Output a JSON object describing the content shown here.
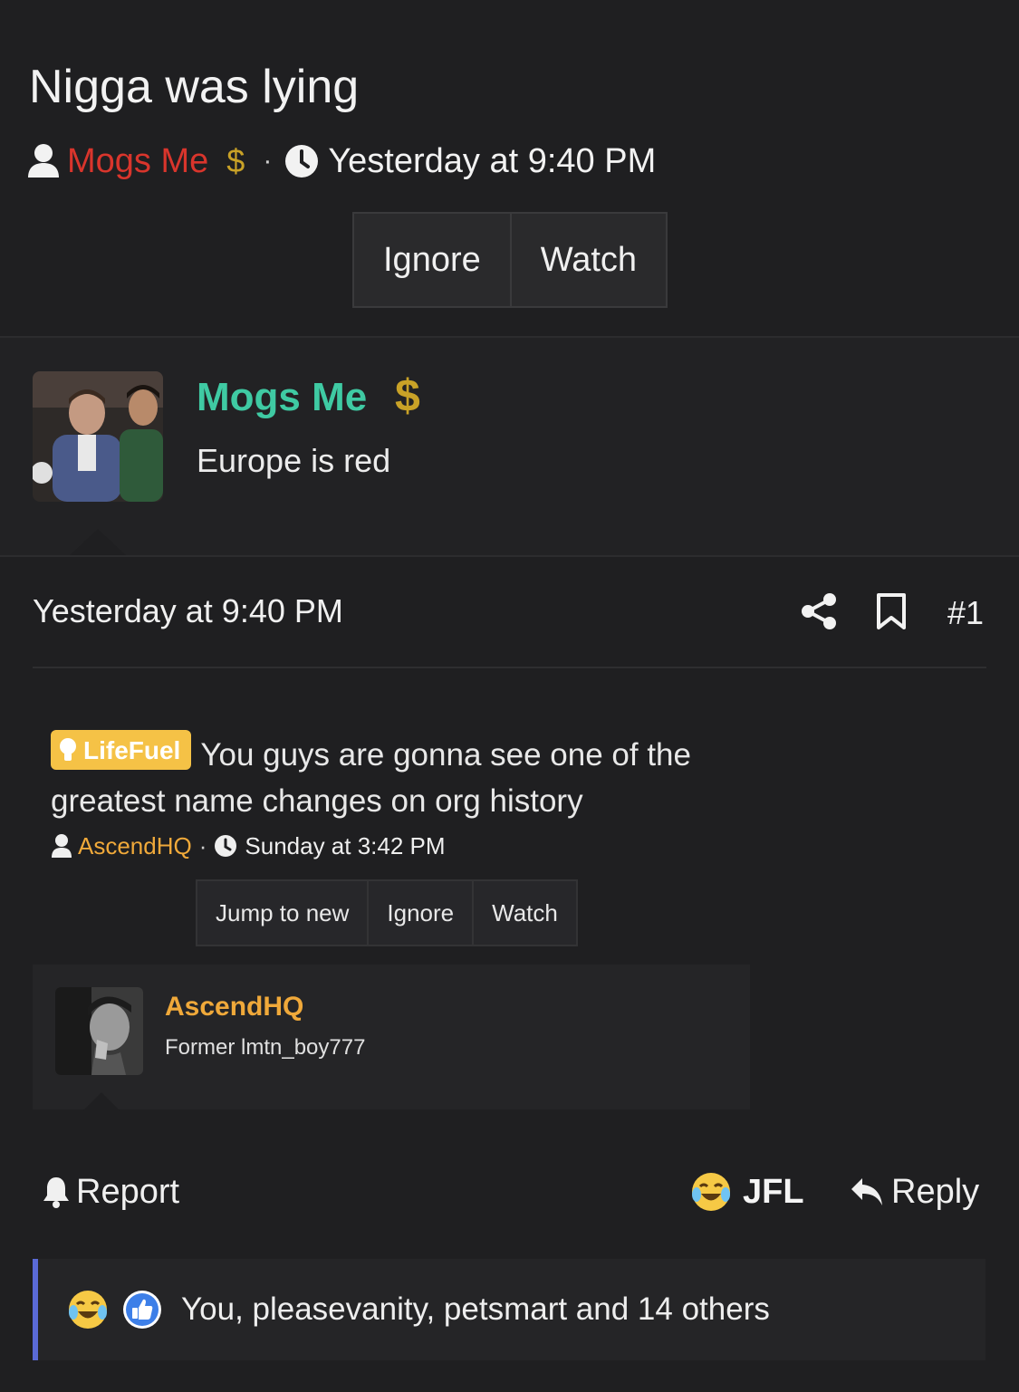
{
  "thread": {
    "title": "Nigga was lying",
    "author": "Mogs Me",
    "author_badge": "$",
    "separator": "·",
    "time": "Yesterday at 9:40 PM",
    "buttons": {
      "ignore": "Ignore",
      "watch": "Watch"
    }
  },
  "post": {
    "username": "Mogs Me",
    "username_color": "#3fcaa3",
    "badge": "$",
    "user_title": "Europe is red",
    "date": "Yesterday at 9:40 PM",
    "number": "#1",
    "icons": [
      "share-icon",
      "bookmark-icon"
    ]
  },
  "embed": {
    "prefix": "LifeFuel",
    "prefix_color": "#f5c246",
    "title": "You guys are gonna see one of the greatest name changes on org history",
    "author": "AscendHQ",
    "separator": "·",
    "time": "Sunday at 3:42 PM",
    "buttons": {
      "jump": "Jump to new",
      "ignore": "Ignore",
      "watch": "Watch"
    },
    "user": {
      "username": "AscendHQ",
      "username_color": "#f0a93a",
      "user_title": "Former lmtn_boy777"
    }
  },
  "actions": {
    "report": "Report",
    "jfl": "JFL",
    "reply": "Reply"
  },
  "reactions": {
    "icons": [
      "crying-laughing-emoji",
      "thumbs-up-emoji"
    ],
    "text": "You, pleasevanity, petsmart and 14 others",
    "accent": "#5a6ad6"
  }
}
